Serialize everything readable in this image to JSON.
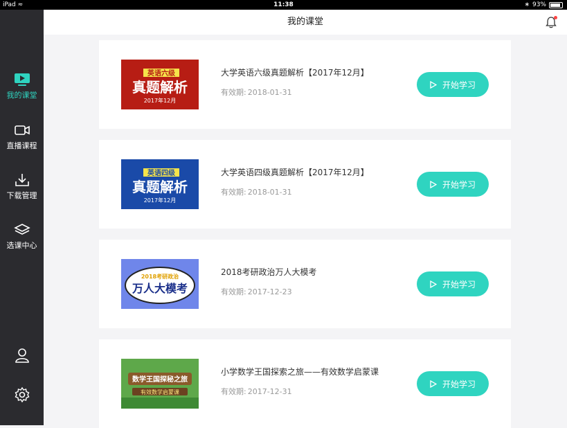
{
  "statusbar": {
    "device": "iPad",
    "time": "11:38",
    "battery": "93%"
  },
  "header": {
    "title": "我的课堂"
  },
  "sidebar": {
    "items": [
      {
        "label": "我的课堂",
        "active": true
      },
      {
        "label": "直播课程"
      },
      {
        "label": "下载管理"
      },
      {
        "label": "选课中心"
      }
    ]
  },
  "courses": [
    {
      "title": "大学英语六级真题解析【2017年12月】",
      "validity_label": "有效期:",
      "validity_date": "2018-01-31",
      "button": "开始学习",
      "thumb": {
        "tag": "英语六级",
        "main": "真题解析",
        "sub": "2017年12月",
        "color": "#c0241a"
      }
    },
    {
      "title": "大学英语四级真题解析【2017年12月】",
      "validity_label": "有效期:",
      "validity_date": "2018-01-31",
      "button": "开始学习",
      "thumb": {
        "tag": "英语四级",
        "main": "真题解析",
        "sub": "2017年12月",
        "color": "#1d4fb0"
      }
    },
    {
      "title": "2018考研政治万人大模考",
      "validity_label": "有效期:",
      "validity_date": "2017-12-23",
      "button": "开始学习",
      "thumb": {
        "tag": "2018考研政治",
        "main": "万人大模考",
        "color": "#6f86ea"
      }
    },
    {
      "title": "小学数学王国探索之旅——有效数学启蒙课",
      "validity_label": "有效期:",
      "validity_date": "2017-12-31",
      "button": "开始学习",
      "thumb": {
        "main": "数学王国探秘之旅",
        "sub": "有效数学启蒙课",
        "color": "#5ea84a"
      }
    }
  ],
  "colors": {
    "accent": "#2fd4c0",
    "sidebar": "#2b2b2f"
  }
}
